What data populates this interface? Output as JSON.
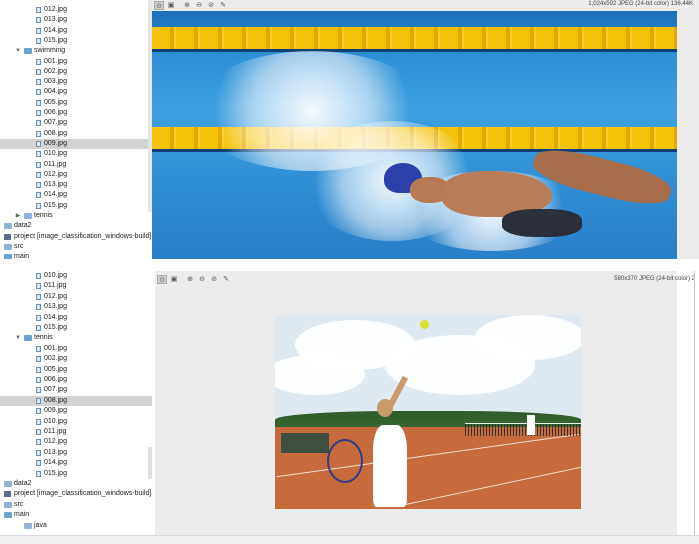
{
  "top": {
    "image_info": "1,024x592 JPEG (24-bit color) 136.44K",
    "tree": [
      {
        "label": "012.jpg",
        "type": "file",
        "indent": 2
      },
      {
        "label": "013.jpg",
        "type": "file",
        "indent": 2
      },
      {
        "label": "014.jpg",
        "type": "file",
        "indent": 2
      },
      {
        "label": "015.jpg",
        "type": "file",
        "indent": 2
      },
      {
        "label": "swimming",
        "type": "folder",
        "indent": 1,
        "open": true
      },
      {
        "label": "001.jpg",
        "type": "file",
        "indent": 2
      },
      {
        "label": "002.jpg",
        "type": "file",
        "indent": 2
      },
      {
        "label": "003.jpg",
        "type": "file",
        "indent": 2
      },
      {
        "label": "004.jpg",
        "type": "file",
        "indent": 2
      },
      {
        "label": "005.jpg",
        "type": "file",
        "indent": 2
      },
      {
        "label": "006.jpg",
        "type": "file",
        "indent": 2
      },
      {
        "label": "007.jpg",
        "type": "file",
        "indent": 2
      },
      {
        "label": "008.jpg",
        "type": "file",
        "indent": 2
      },
      {
        "label": "009.jpg",
        "type": "file",
        "indent": 2,
        "selected": true
      },
      {
        "label": "010.jpg",
        "type": "file",
        "indent": 2
      },
      {
        "label": "011.jpg",
        "type": "file",
        "indent": 2
      },
      {
        "label": "012.jpg",
        "type": "file",
        "indent": 2
      },
      {
        "label": "013.jpg",
        "type": "file",
        "indent": 2
      },
      {
        "label": "014.jpg",
        "type": "file",
        "indent": 2
      },
      {
        "label": "015.jpg",
        "type": "file",
        "indent": 2
      },
      {
        "label": "tennis",
        "type": "folder",
        "indent": 1,
        "open": false
      },
      {
        "label": "data2",
        "type": "folder",
        "indent": 0
      },
      {
        "label": "project [image_classification_windows-build]",
        "suffix": "sour",
        "type": "module",
        "indent": 0
      },
      {
        "label": "src",
        "type": "folder",
        "indent": 0
      },
      {
        "label": "main",
        "type": "folder",
        "indent": 0,
        "open": true
      }
    ]
  },
  "bottom": {
    "image_info": "580x370 JPEG (24-bit color) 2",
    "tree": [
      {
        "label": "010.jpg",
        "type": "file",
        "indent": 2
      },
      {
        "label": "011.jpg",
        "type": "file",
        "indent": 2
      },
      {
        "label": "012.jpg",
        "type": "file",
        "indent": 2
      },
      {
        "label": "013.jpg",
        "type": "file",
        "indent": 2
      },
      {
        "label": "014.jpg",
        "type": "file",
        "indent": 2
      },
      {
        "label": "015.jpg",
        "type": "file",
        "indent": 2
      },
      {
        "label": "tennis",
        "type": "folder",
        "indent": 1,
        "open": true
      },
      {
        "label": "001.jpg",
        "type": "file",
        "indent": 2
      },
      {
        "label": "002.jpg",
        "type": "file",
        "indent": 2
      },
      {
        "label": "005.jpg",
        "type": "file",
        "indent": 2
      },
      {
        "label": "006.jpg",
        "type": "file",
        "indent": 2
      },
      {
        "label": "007.jpg",
        "type": "file",
        "indent": 2
      },
      {
        "label": "008.jpg",
        "type": "file",
        "indent": 2,
        "selected": true
      },
      {
        "label": "009.jpg",
        "type": "file",
        "indent": 2
      },
      {
        "label": "010.jpg",
        "type": "file",
        "indent": 2
      },
      {
        "label": "011.jpg",
        "type": "file",
        "indent": 2
      },
      {
        "label": "012.jpg",
        "type": "file",
        "indent": 2
      },
      {
        "label": "013.jpg",
        "type": "file",
        "indent": 2
      },
      {
        "label": "014.jpg",
        "type": "file",
        "indent": 2
      },
      {
        "label": "015.jpg",
        "type": "file",
        "indent": 2
      },
      {
        "label": "data2",
        "type": "folder",
        "indent": 0
      },
      {
        "label": "project [image_classification_windows-build]",
        "suffix": "sou",
        "type": "module",
        "indent": 0
      },
      {
        "label": "src",
        "type": "folder",
        "indent": 0
      },
      {
        "label": "main",
        "type": "folder",
        "indent": 0,
        "open": true
      },
      {
        "label": "java",
        "type": "folder",
        "indent": 1
      }
    ]
  },
  "toolbar": [
    {
      "icon": "fit-view-icon",
      "glyph": "⊙"
    },
    {
      "icon": "actual-size-icon",
      "glyph": "▣"
    },
    {
      "icon": "zoom-in-icon",
      "glyph": "⊕"
    },
    {
      "icon": "zoom-out-icon",
      "glyph": "⊖"
    },
    {
      "icon": "zoom-reset-icon",
      "glyph": "⊘"
    },
    {
      "icon": "color-picker-icon",
      "glyph": "✎"
    }
  ],
  "colors": {
    "selection": "#d3d3d3",
    "viewer_bg": "#ececec",
    "lane_yellow": "#f5c20b",
    "pool_blue": "#2d8fd6",
    "court_clay": "#c76a3c"
  }
}
